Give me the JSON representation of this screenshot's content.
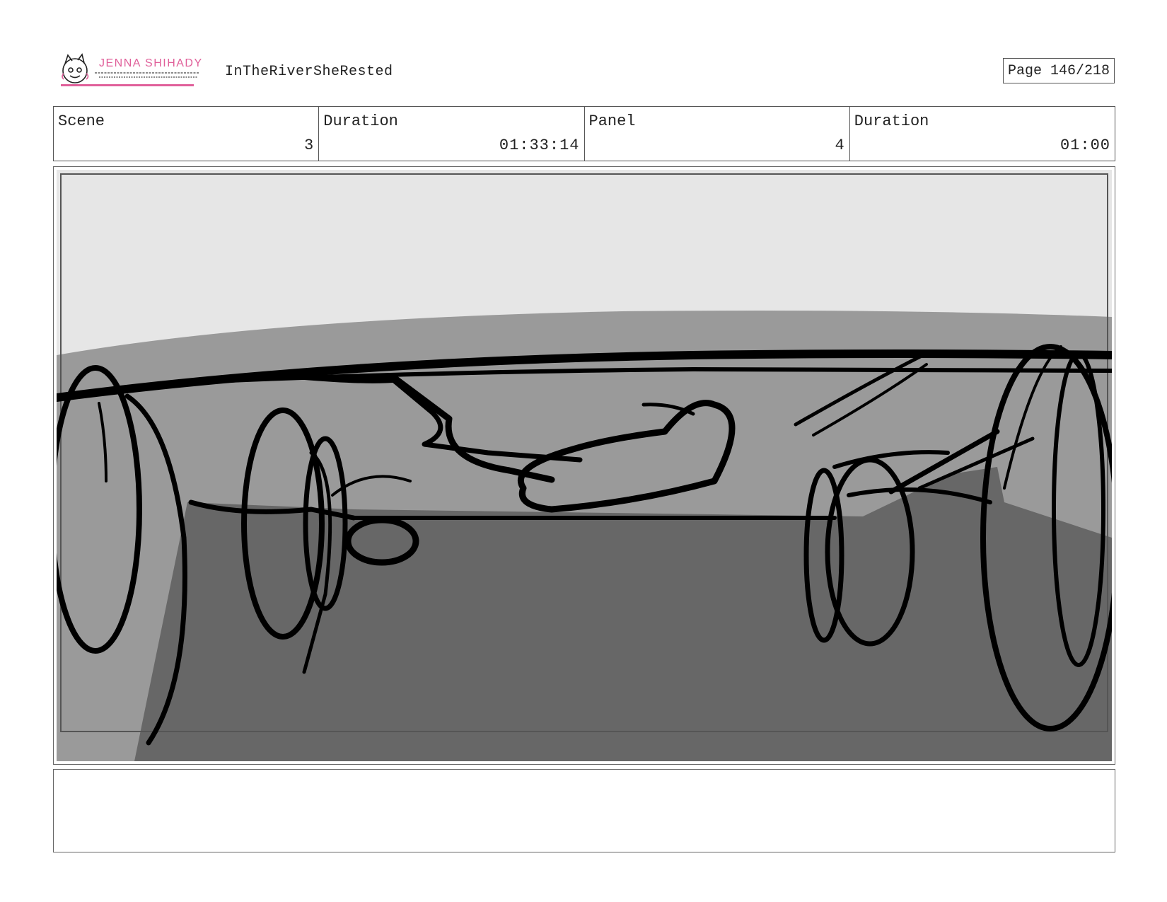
{
  "header": {
    "logo_text": "JENNA SHIHADY",
    "project_title": "InTheRiverSheRested",
    "page_label": "Page 146/218"
  },
  "info": {
    "scene_label": "Scene",
    "scene_value": "3",
    "scene_duration_label": "Duration",
    "scene_duration_value": "01:33:14",
    "panel_label": "Panel",
    "panel_value": "4",
    "panel_duration_label": "Duration",
    "panel_duration_value": "01:00"
  },
  "notes": {
    "text": ""
  },
  "colors": {
    "logo_pink": "#e0609a",
    "sky": "#e6e6e6",
    "mid_gray": "#9a9a9a",
    "ground": "#676767",
    "ink": "#000000"
  }
}
